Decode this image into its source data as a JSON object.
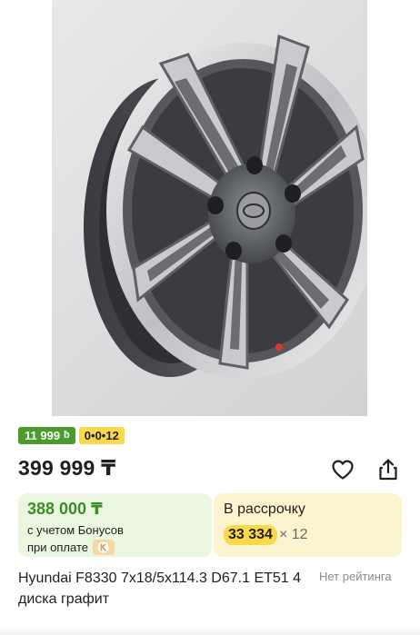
{
  "product": {
    "image_alt": "Hyundai alloy wheel, graphite with polished face",
    "badges": {
      "price": "11 999",
      "bonus_icon": "bonus-b-icon",
      "installment": "0•0•12"
    },
    "price": "399 999 ₸",
    "actions": {
      "favorite_icon": "heart-icon",
      "share_icon": "share-icon"
    },
    "bonus_card": {
      "price": "388 000 ₸",
      "line1": "с учетом Бонусов",
      "line2": "при оплате",
      "payment_icon": "kaspi-pay-icon"
    },
    "installment_card": {
      "title": "В рассрочку",
      "amount": "33 334",
      "months": "× 12"
    },
    "title": "Hyundai F8330 7x18/5x114.3 D67.1 ET51 4 диска графит",
    "rating": "Нет рейтинга"
  },
  "colors": {
    "green_badge": "#4a9a2e",
    "yellow_badge": "#f9d94a",
    "bonus_card_bg": "#eaf6e0",
    "installment_card_bg": "#fcf3cf",
    "bonus_price": "#3b8d2a"
  }
}
